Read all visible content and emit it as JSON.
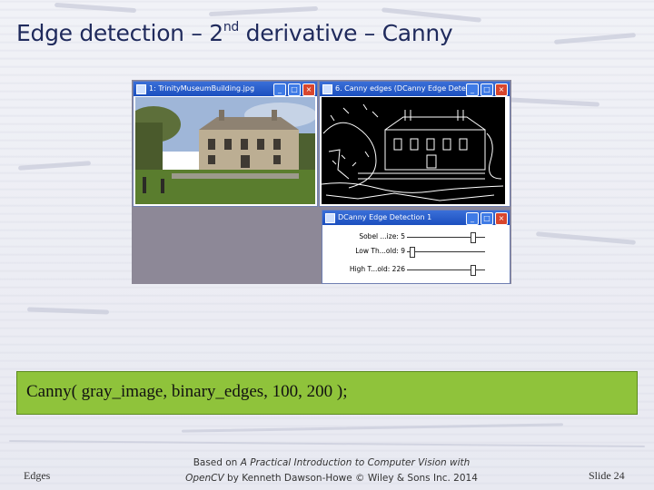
{
  "slide": {
    "title_main": "Edge detection – 2",
    "title_sup": "nd",
    "title_rest": " derivative – Canny"
  },
  "screenshot": {
    "photo_window": {
      "title": "1: TrinityMuseumBuilding.jpg"
    },
    "edges_window": {
      "title": "6. Canny edges (DCanny Edge Dete..."
    },
    "control_window": {
      "title": "DCanny Edge Detection 1",
      "params": [
        {
          "label": "Sobel ...ize: 5",
          "value_fraction": 0.88
        },
        {
          "label": "Low Th...old: 9",
          "value_fraction": 0.04
        },
        {
          "label": "High T...old: 226",
          "value_fraction": 0.88
        }
      ]
    },
    "window_buttons": {
      "minimize": "_",
      "maximize": "□",
      "close": "×"
    }
  },
  "code": {
    "text": "Canny( gray_image, binary_edges, 100, 200 );"
  },
  "footer": {
    "left": "Edges",
    "center_line1_prefix": "Based on ",
    "center_line1_italic": "A Practical Introduction to Computer Vision with",
    "center_line2_italic": "OpenCV",
    "center_line2_rest": " by Kenneth Dawson-Howe © Wiley & Sons Inc. 2014",
    "right": "Slide 24"
  },
  "colors": {
    "title": "#1f2a5c",
    "code_box": "#8fc33b",
    "screen_bg": "#8d8897",
    "titlebar": "#1b4fbf"
  }
}
